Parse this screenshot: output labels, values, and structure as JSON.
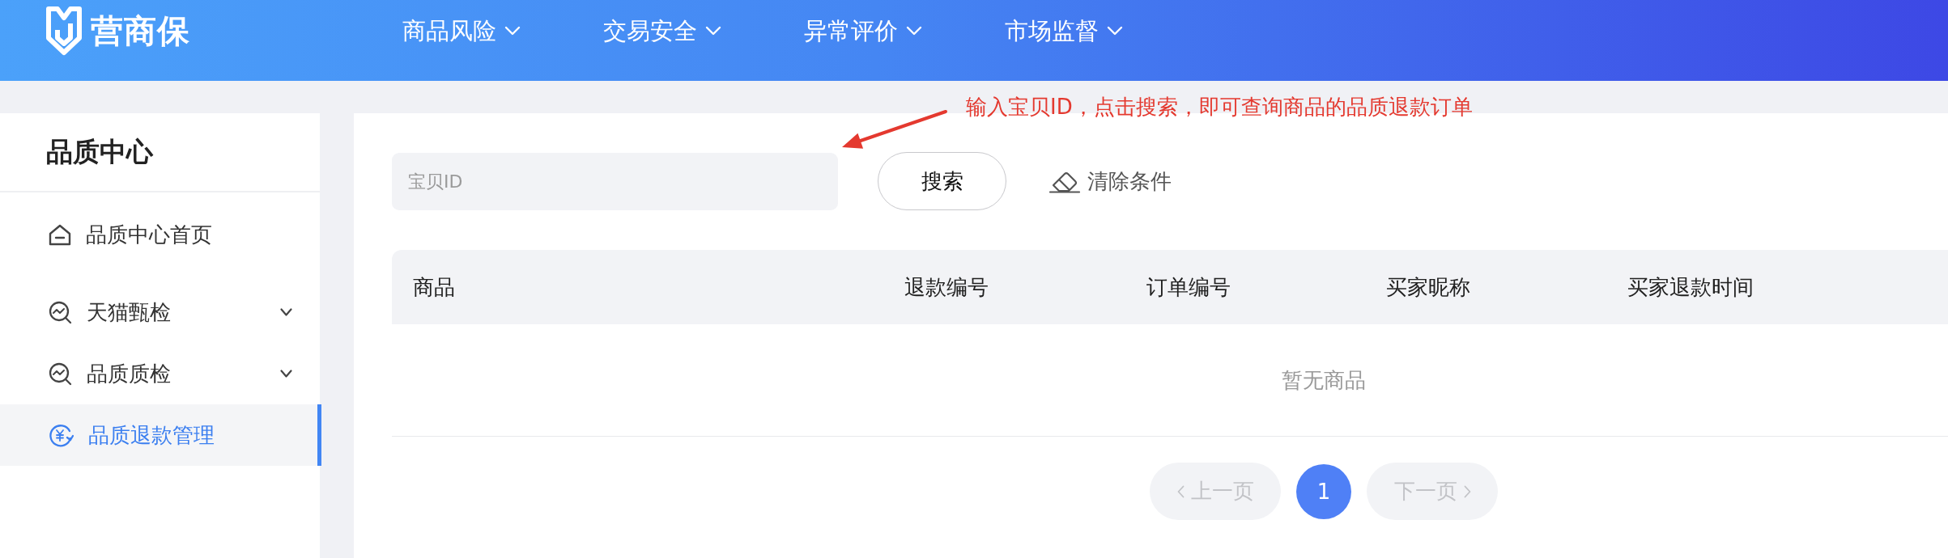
{
  "header": {
    "logo": "营商保",
    "nav": [
      {
        "label": "商品风险",
        "expanded": false
      },
      {
        "label": "交易安全",
        "expanded": false
      },
      {
        "label": "异常评价",
        "expanded": false
      },
      {
        "label": "市场监督",
        "expanded": false
      }
    ]
  },
  "sidebar": {
    "title": "品质中心",
    "items": [
      {
        "label": "品质中心首页",
        "kind": "home",
        "selected": false
      },
      {
        "label": "天猫甄检",
        "kind": "group",
        "expanded": false,
        "selected": false
      },
      {
        "label": "品质质检",
        "kind": "group",
        "expanded": false,
        "selected": false
      },
      {
        "label": "品质退款管理",
        "kind": "refund",
        "selected": true
      }
    ]
  },
  "annotation": {
    "text": "输入宝贝ID，点击搜索，即可查询商品的品质退款订单"
  },
  "search": {
    "placeholder": "宝贝ID",
    "search_button": "搜索",
    "clear_button": "清除条件"
  },
  "table": {
    "columns": [
      "商品",
      "退款编号",
      "订单编号",
      "买家昵称",
      "买家退款时间"
    ],
    "empty_text": "暂无商品"
  },
  "pagination": {
    "prev": {
      "label": "上一页",
      "disabled": true
    },
    "pages": [
      {
        "label": "1",
        "selected": true
      }
    ],
    "next": {
      "label": "下一页",
      "disabled": true
    }
  }
}
